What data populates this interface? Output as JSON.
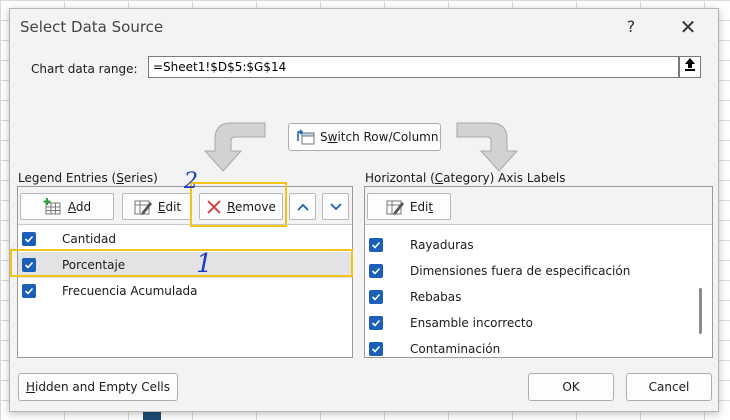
{
  "dialog": {
    "title": "Select Data Source",
    "help_glyph": "?",
    "close_glyph": "✕"
  },
  "range": {
    "label": "Chart data range:",
    "value": "=Sheet1!$D$5:$G$14"
  },
  "switch": {
    "label_pre": "S",
    "label_key": "w",
    "label_post": "itch Row/Column"
  },
  "legend": {
    "label_pre": "Legend Entries (",
    "label_key": "S",
    "label_post": "eries)",
    "add_pre": "",
    "add_key": "A",
    "add_post": "dd",
    "edit_pre": "",
    "edit_key": "E",
    "edit_post": "dit",
    "remove_pre": "",
    "remove_key": "R",
    "remove_post": "emove",
    "items": [
      {
        "label": "Cantidad",
        "checked": true
      },
      {
        "label": "Porcentaje",
        "checked": true,
        "selected": true
      },
      {
        "label": "Frecuencia Acumulada",
        "checked": true
      }
    ]
  },
  "axis": {
    "label_pre": "Horizontal (",
    "label_key": "C",
    "label_post": "ategory) Axis Labels",
    "edit_pre": "Edi",
    "edit_key": "t",
    "edit_post": "",
    "items": [
      {
        "label": "Rayaduras",
        "checked": true
      },
      {
        "label": "Dimensiones fuera de especificación",
        "checked": true
      },
      {
        "label": "Rebabas",
        "checked": true
      },
      {
        "label": "Ensamble incorrecto",
        "checked": true
      },
      {
        "label": "Contaminación",
        "checked": true
      }
    ]
  },
  "footer": {
    "hidden_pre": "",
    "hidden_key": "H",
    "hidden_post": "idden and Empty Cells",
    "ok": "OK",
    "cancel": "Cancel"
  },
  "annotations": {
    "one": "1",
    "two": "2"
  },
  "colors": {
    "checkbox": "#1b5fb8",
    "highlight": "#f0c419",
    "annotation": "#1f3cc4",
    "remove_x": "#d13438"
  }
}
